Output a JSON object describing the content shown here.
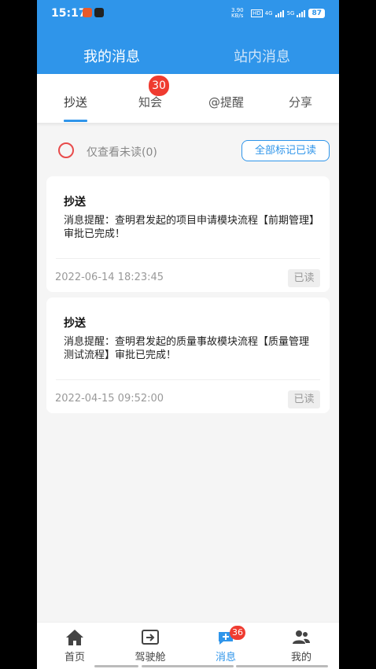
{
  "status_bar": {
    "time": "15:17",
    "net_speed": "3.90 KB/s",
    "hd": "HD",
    "signal_4g": "4G",
    "signal_5g": "5G",
    "battery": "87"
  },
  "header": {
    "tabs": [
      {
        "label": "我的消息",
        "active": true
      },
      {
        "label": "站内消息",
        "active": false
      }
    ]
  },
  "subtabs": {
    "items": [
      {
        "label": "抄送",
        "active": true
      },
      {
        "label": "知会",
        "badge": "30"
      },
      {
        "label": "@提醒"
      },
      {
        "label": "分享"
      }
    ]
  },
  "filter": {
    "unread_only_label": "仅查看未读(0)",
    "mark_all_read_label": "全部标记已读"
  },
  "messages": [
    {
      "title": "抄送",
      "body": "消息提醒：查明君发起的项目申请模块流程【前期管理】审批已完成！",
      "time": "2022-06-14 18:23:45",
      "status": "已读"
    },
    {
      "title": "抄送",
      "body": "消息提醒：查明君发起的质量事故模块流程【质量管理测试流程】审批已完成！",
      "time": "2022-04-15 09:52:00",
      "status": "已读"
    }
  ],
  "bottom_nav": {
    "items": [
      {
        "label": "首页",
        "icon": "home-icon"
      },
      {
        "label": "驾驶舱",
        "icon": "cockpit-icon"
      },
      {
        "label": "消息",
        "icon": "message-icon",
        "badge": "36",
        "active": true
      },
      {
        "label": "我的",
        "icon": "users-icon"
      }
    ]
  },
  "colors": {
    "primary": "#2f95ea",
    "badge": "#ef3b30",
    "radio": "#e84b4b"
  }
}
